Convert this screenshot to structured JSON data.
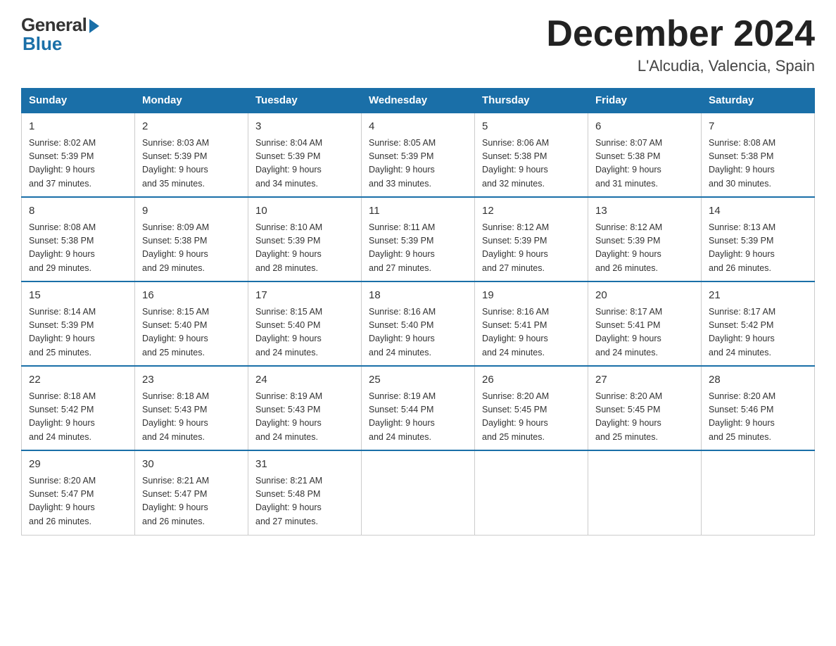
{
  "header": {
    "logo_general": "General",
    "logo_blue": "Blue",
    "title": "December 2024",
    "location": "L'Alcudia, Valencia, Spain"
  },
  "columns": [
    "Sunday",
    "Monday",
    "Tuesday",
    "Wednesday",
    "Thursday",
    "Friday",
    "Saturday"
  ],
  "weeks": [
    [
      {
        "day": "1",
        "info": "Sunrise: 8:02 AM\nSunset: 5:39 PM\nDaylight: 9 hours\nand 37 minutes."
      },
      {
        "day": "2",
        "info": "Sunrise: 8:03 AM\nSunset: 5:39 PM\nDaylight: 9 hours\nand 35 minutes."
      },
      {
        "day": "3",
        "info": "Sunrise: 8:04 AM\nSunset: 5:39 PM\nDaylight: 9 hours\nand 34 minutes."
      },
      {
        "day": "4",
        "info": "Sunrise: 8:05 AM\nSunset: 5:39 PM\nDaylight: 9 hours\nand 33 minutes."
      },
      {
        "day": "5",
        "info": "Sunrise: 8:06 AM\nSunset: 5:38 PM\nDaylight: 9 hours\nand 32 minutes."
      },
      {
        "day": "6",
        "info": "Sunrise: 8:07 AM\nSunset: 5:38 PM\nDaylight: 9 hours\nand 31 minutes."
      },
      {
        "day": "7",
        "info": "Sunrise: 8:08 AM\nSunset: 5:38 PM\nDaylight: 9 hours\nand 30 minutes."
      }
    ],
    [
      {
        "day": "8",
        "info": "Sunrise: 8:08 AM\nSunset: 5:38 PM\nDaylight: 9 hours\nand 29 minutes."
      },
      {
        "day": "9",
        "info": "Sunrise: 8:09 AM\nSunset: 5:38 PM\nDaylight: 9 hours\nand 29 minutes."
      },
      {
        "day": "10",
        "info": "Sunrise: 8:10 AM\nSunset: 5:39 PM\nDaylight: 9 hours\nand 28 minutes."
      },
      {
        "day": "11",
        "info": "Sunrise: 8:11 AM\nSunset: 5:39 PM\nDaylight: 9 hours\nand 27 minutes."
      },
      {
        "day": "12",
        "info": "Sunrise: 8:12 AM\nSunset: 5:39 PM\nDaylight: 9 hours\nand 27 minutes."
      },
      {
        "day": "13",
        "info": "Sunrise: 8:12 AM\nSunset: 5:39 PM\nDaylight: 9 hours\nand 26 minutes."
      },
      {
        "day": "14",
        "info": "Sunrise: 8:13 AM\nSunset: 5:39 PM\nDaylight: 9 hours\nand 26 minutes."
      }
    ],
    [
      {
        "day": "15",
        "info": "Sunrise: 8:14 AM\nSunset: 5:39 PM\nDaylight: 9 hours\nand 25 minutes."
      },
      {
        "day": "16",
        "info": "Sunrise: 8:15 AM\nSunset: 5:40 PM\nDaylight: 9 hours\nand 25 minutes."
      },
      {
        "day": "17",
        "info": "Sunrise: 8:15 AM\nSunset: 5:40 PM\nDaylight: 9 hours\nand 24 minutes."
      },
      {
        "day": "18",
        "info": "Sunrise: 8:16 AM\nSunset: 5:40 PM\nDaylight: 9 hours\nand 24 minutes."
      },
      {
        "day": "19",
        "info": "Sunrise: 8:16 AM\nSunset: 5:41 PM\nDaylight: 9 hours\nand 24 minutes."
      },
      {
        "day": "20",
        "info": "Sunrise: 8:17 AM\nSunset: 5:41 PM\nDaylight: 9 hours\nand 24 minutes."
      },
      {
        "day": "21",
        "info": "Sunrise: 8:17 AM\nSunset: 5:42 PM\nDaylight: 9 hours\nand 24 minutes."
      }
    ],
    [
      {
        "day": "22",
        "info": "Sunrise: 8:18 AM\nSunset: 5:42 PM\nDaylight: 9 hours\nand 24 minutes."
      },
      {
        "day": "23",
        "info": "Sunrise: 8:18 AM\nSunset: 5:43 PM\nDaylight: 9 hours\nand 24 minutes."
      },
      {
        "day": "24",
        "info": "Sunrise: 8:19 AM\nSunset: 5:43 PM\nDaylight: 9 hours\nand 24 minutes."
      },
      {
        "day": "25",
        "info": "Sunrise: 8:19 AM\nSunset: 5:44 PM\nDaylight: 9 hours\nand 24 minutes."
      },
      {
        "day": "26",
        "info": "Sunrise: 8:20 AM\nSunset: 5:45 PM\nDaylight: 9 hours\nand 25 minutes."
      },
      {
        "day": "27",
        "info": "Sunrise: 8:20 AM\nSunset: 5:45 PM\nDaylight: 9 hours\nand 25 minutes."
      },
      {
        "day": "28",
        "info": "Sunrise: 8:20 AM\nSunset: 5:46 PM\nDaylight: 9 hours\nand 25 minutes."
      }
    ],
    [
      {
        "day": "29",
        "info": "Sunrise: 8:20 AM\nSunset: 5:47 PM\nDaylight: 9 hours\nand 26 minutes."
      },
      {
        "day": "30",
        "info": "Sunrise: 8:21 AM\nSunset: 5:47 PM\nDaylight: 9 hours\nand 26 minutes."
      },
      {
        "day": "31",
        "info": "Sunrise: 8:21 AM\nSunset: 5:48 PM\nDaylight: 9 hours\nand 27 minutes."
      },
      {
        "day": "",
        "info": ""
      },
      {
        "day": "",
        "info": ""
      },
      {
        "day": "",
        "info": ""
      },
      {
        "day": "",
        "info": ""
      }
    ]
  ]
}
